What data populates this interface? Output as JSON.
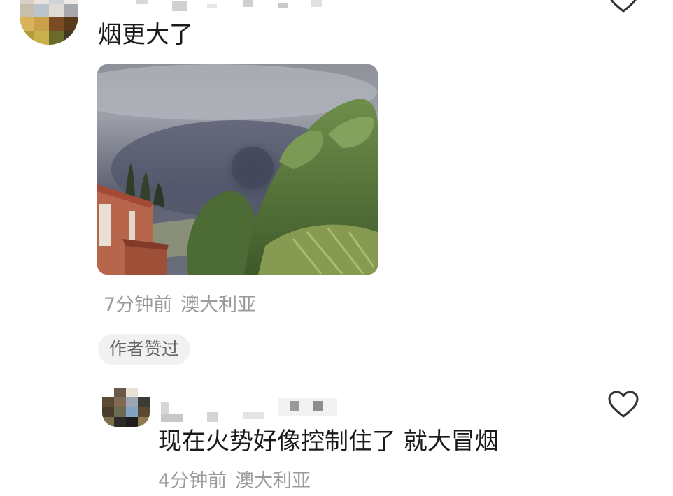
{
  "comment1": {
    "text": "烟更大了",
    "time": "7分钟前",
    "location": "澳大利亚",
    "author_liked_badge": "作者赞过"
  },
  "reply1": {
    "text": "现在火势好像控制住了 就大冒烟",
    "time": "4分钟前",
    "location": "澳大利亚"
  },
  "icons": {
    "like": "heart-outline-icon"
  },
  "colors": {
    "text_primary": "#1a1a1a",
    "text_meta": "#9b9b9b",
    "badge_bg": "#f1f1f1",
    "icon_stroke": "#333333"
  }
}
